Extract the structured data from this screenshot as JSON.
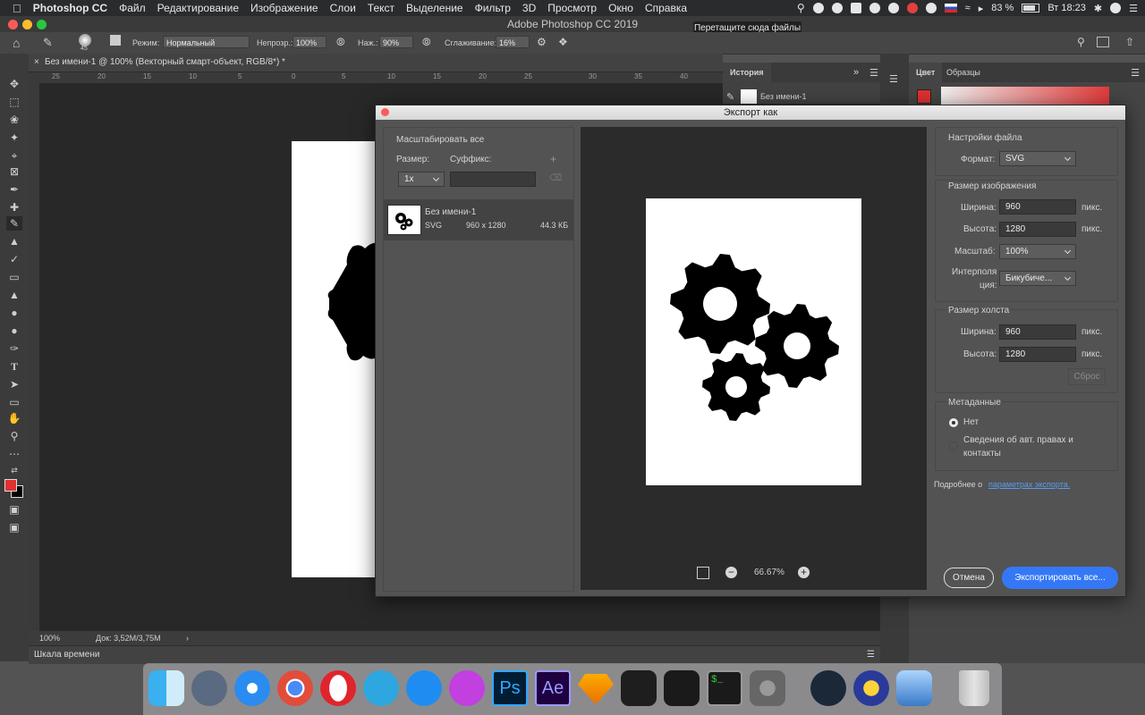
{
  "menubar": {
    "app": "Photoshop CC",
    "items": [
      "Файл",
      "Редактирование",
      "Изображение",
      "Слои",
      "Текст",
      "Выделение",
      "Фильтр",
      "3D",
      "Просмотр",
      "Окно",
      "Справка"
    ],
    "battery": "83 %",
    "clock": "Вт 18:23"
  },
  "window": {
    "title": "Adobe Photoshop CC 2019",
    "tooltip": "Перетащите сюда файлы"
  },
  "options_bar": {
    "brush_size": "45",
    "mode_label": "Режим:",
    "mode_value": "Нормальный",
    "opacity_label": "Непрозр.:",
    "opacity_value": "100%",
    "pressure_label": "Наж.:",
    "pressure_value": "90%",
    "smoothing_label": "Сглаживание:",
    "smoothing_value": "16%"
  },
  "document": {
    "tab_title": "Без имени-1 @ 100% (Векторный смарт-объект, RGB/8*) *",
    "ruler_ticks": [
      "25",
      "20",
      "15",
      "10",
      "5",
      "0",
      "5",
      "10",
      "15",
      "20",
      "25",
      "30",
      "35",
      "40"
    ],
    "zoom": "100%",
    "doc_info": "Док: 3,52M/3,75M",
    "timeline": "Шкала времени"
  },
  "panels": {
    "history_tab": "История",
    "history_item": "Без имени-1",
    "color_tab": "Цвет",
    "swatches_tab": "Образцы"
  },
  "colors": {
    "foreground": "#e03030",
    "accent": "#3478f6",
    "link": "#5b9bf0"
  },
  "dialog": {
    "title": "Экспорт как",
    "scale_all": {
      "heading": "Масштабировать все",
      "size_label": "Размер:",
      "suffix_label": "Суффикс:",
      "size_value": "1x",
      "add_icon": "plus-icon",
      "delete_icon": "trash-icon"
    },
    "asset": {
      "name": "Без имени-1",
      "format": "SVG",
      "dimensions": "960 x 1280",
      "filesize": "44.3 КБ"
    },
    "preview": {
      "zoom": "66.67%"
    },
    "file_settings": {
      "heading": "Настройки файла",
      "format_label": "Формат:",
      "format_value": "SVG"
    },
    "image_size": {
      "heading": "Размер изображения",
      "width_label": "Ширина:",
      "width_value": "960",
      "width_unit": "пикс.",
      "height_label": "Высота:",
      "height_value": "1280",
      "height_unit": "пикс.",
      "scale_label": "Масштаб:",
      "scale_value": "100%",
      "interp_label_1": "Интерполя",
      "interp_label_2": "ция:",
      "interp_value": "Бикубиче..."
    },
    "canvas_size": {
      "heading": "Размер холста",
      "width_label": "Ширина:",
      "width_value": "960",
      "width_unit": "пикс.",
      "height_label": "Высота:",
      "height_value": "1280",
      "height_unit": "пикс.",
      "reset": "Сброс"
    },
    "metadata": {
      "heading": "Метаданные",
      "opt_none": "Нет",
      "opt_copyright_1": "Сведения об авт. правах и",
      "opt_copyright_2": "контакты"
    },
    "more_info_prefix": "Подробнее о",
    "more_info_link": "параметрах экспорта.",
    "cancel": "Отмена",
    "export": "Экспортировать все..."
  },
  "dock": [
    "finder-icon",
    "launchpad-icon",
    "safari-icon",
    "chrome-icon",
    "opera-icon",
    "telegram-icon",
    "app-store-icon",
    "picsart-icon",
    "photoshop-icon",
    "after-effects-icon",
    "sketch-icon",
    "figma-icon",
    "vectorize-icon",
    "terminal-icon",
    "system-preferences-icon",
    "steam-icon",
    "bolt-app-icon",
    "preview-icon",
    "trash-icon"
  ],
  "dock_labels": {
    "ps": "Ps",
    "ae": "Ae",
    "terminal": "$_"
  }
}
